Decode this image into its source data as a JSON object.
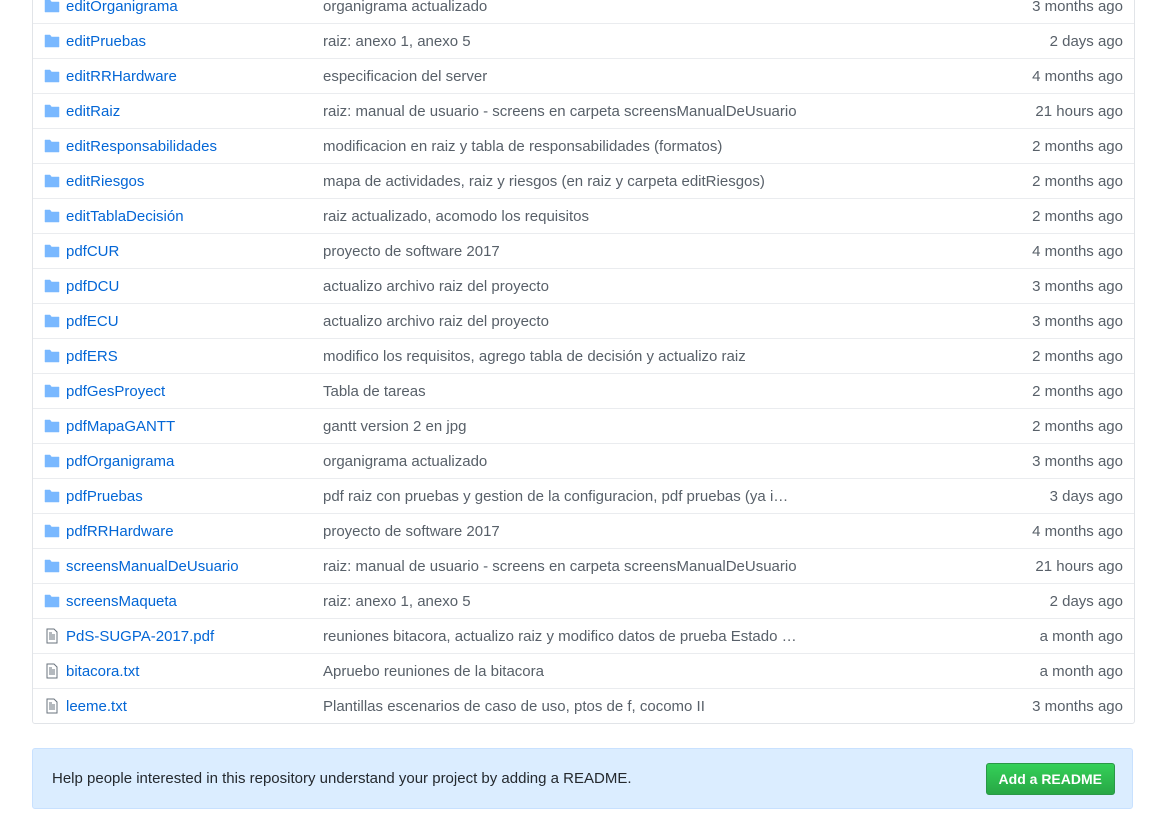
{
  "files": [
    {
      "type": "dir",
      "name": "editOrganigrama",
      "message": "organigrama actualizado",
      "age": "3 months ago"
    },
    {
      "type": "dir",
      "name": "editPruebas",
      "message": "raiz: anexo 1, anexo 5",
      "age": "2 days ago"
    },
    {
      "type": "dir",
      "name": "editRRHardware",
      "message": "especificacion del server",
      "age": "4 months ago"
    },
    {
      "type": "dir",
      "name": "editRaiz",
      "message": "raiz: manual de usuario - screens en carpeta screensManualDeUsuario",
      "age": "21 hours ago"
    },
    {
      "type": "dir",
      "name": "editResponsabilidades",
      "message": "modificacion en raiz y tabla de responsabilidades (formatos)",
      "age": "2 months ago"
    },
    {
      "type": "dir",
      "name": "editRiesgos",
      "message": "mapa de actividades, raiz y riesgos (en raiz y carpeta editRiesgos)",
      "age": "2 months ago"
    },
    {
      "type": "dir",
      "name": "editTablaDecisión",
      "message": "raiz actualizado, acomodo los requisitos",
      "age": "2 months ago"
    },
    {
      "type": "dir",
      "name": "pdfCUR",
      "message": "proyecto de software 2017",
      "age": "4 months ago"
    },
    {
      "type": "dir",
      "name": "pdfDCU",
      "message": "actualizo archivo raiz del proyecto",
      "age": "3 months ago"
    },
    {
      "type": "dir",
      "name": "pdfECU",
      "message": "actualizo archivo raiz del proyecto",
      "age": "3 months ago"
    },
    {
      "type": "dir",
      "name": "pdfERS",
      "message": "modifico los requisitos, agrego tabla de decisión y actualizo raiz",
      "age": "2 months ago"
    },
    {
      "type": "dir",
      "name": "pdfGesProyect",
      "message": "Tabla de tareas",
      "age": "2 months ago"
    },
    {
      "type": "dir",
      "name": "pdfMapaGANTT",
      "message": "gantt version 2 en jpg",
      "age": "2 months ago"
    },
    {
      "type": "dir",
      "name": "pdfOrganigrama",
      "message": "organigrama actualizado",
      "age": "3 months ago"
    },
    {
      "type": "dir",
      "name": "pdfPruebas",
      "message": "pdf raiz con pruebas y gestion de la configuracion, pdf pruebas (ya i…",
      "age": "3 days ago"
    },
    {
      "type": "dir",
      "name": "pdfRRHardware",
      "message": "proyecto de software 2017",
      "age": "4 months ago"
    },
    {
      "type": "dir",
      "name": "screensManualDeUsuario",
      "message": "raiz: manual de usuario - screens en carpeta screensManualDeUsuario",
      "age": "21 hours ago"
    },
    {
      "type": "dir",
      "name": "screensMaqueta",
      "message": "raiz: anexo 1, anexo 5",
      "age": "2 days ago"
    },
    {
      "type": "file",
      "name": "PdS-SUGPA-2017.pdf",
      "message": "reuniones bitacora, actualizo raiz y modifico datos de prueba Estado …",
      "age": "a month ago"
    },
    {
      "type": "file",
      "name": "bitacora.txt",
      "message": "Apruebo reuniones de la bitacora",
      "age": "a month ago"
    },
    {
      "type": "file",
      "name": "leeme.txt",
      "message": "Plantillas escenarios de caso de uso, ptos de f, cocomo II",
      "age": "3 months ago"
    }
  ],
  "readme_prompt": {
    "text": "Help people interested in this repository understand your project by adding a README.",
    "button_label": "Add a README"
  },
  "colors": {
    "link": "#0366d6",
    "folder_icon": "#79b8ff",
    "muted": "#586069",
    "button": "#28a745"
  },
  "icons": {
    "dir": "folder-icon",
    "file": "file-icon"
  }
}
